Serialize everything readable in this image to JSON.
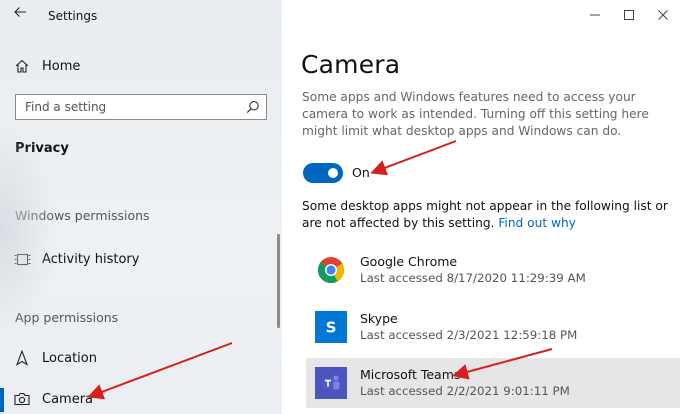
{
  "window": {
    "app_title": "Settings"
  },
  "sidebar": {
    "home_label": "Home",
    "search_placeholder": "Find a setting",
    "section_heading": "Privacy",
    "groups": [
      {
        "label": "Windows permissions",
        "items": [
          {
            "label": "Activity history",
            "icon": "activity-history-icon"
          }
        ]
      },
      {
        "label": "App permissions",
        "items": [
          {
            "label": "Location",
            "icon": "location-icon"
          },
          {
            "label": "Camera",
            "icon": "camera-icon",
            "selected": true
          }
        ]
      }
    ]
  },
  "main": {
    "title": "Camera",
    "description": "Some apps and Windows features need to access your camera to work as intended. Turning off this setting here might limit what desktop apps and Windows can do.",
    "toggle": {
      "state": "On",
      "on": true
    },
    "note": "Some desktop apps might not appear in the following list or are not affected by this setting.",
    "note_link": "Find out why",
    "apps": [
      {
        "name": "Google Chrome",
        "last_accessed": "Last accessed 8/17/2020 11:29:39 AM",
        "icon": "chrome-icon"
      },
      {
        "name": "Skype",
        "last_accessed": "Last accessed 2/3/2021 12:59:18 PM",
        "icon": "skype-icon"
      },
      {
        "name": "Microsoft Teams",
        "last_accessed": "Last accessed 2/2/2021 9:01:11 PM",
        "icon": "teams-icon",
        "selected": true
      }
    ]
  },
  "colors": {
    "accent": "#0067c0",
    "annotation_arrow": "#d81e1e",
    "skype": "#0078d4",
    "teams": "#4b53bc"
  }
}
